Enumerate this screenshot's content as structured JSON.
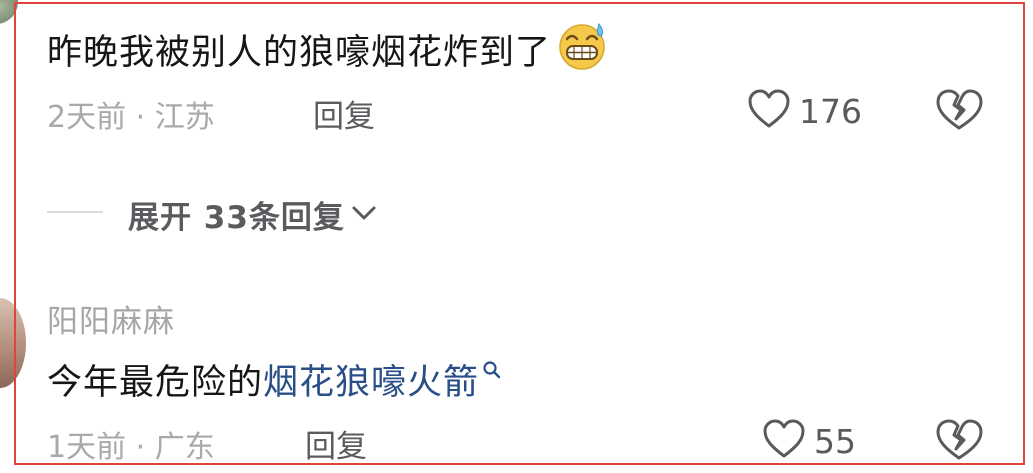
{
  "comment1": {
    "text": "昨晚我被别人的狼嚎烟花炸到了",
    "emoji": "grinning-sweat-emoji",
    "time_location": "2天前 · 江苏",
    "reply_label": "回复",
    "like_count": "176"
  },
  "expand": {
    "label": "展开 33条回复"
  },
  "comment2": {
    "username": "阳阳麻麻",
    "text_plain": "今年最危险的",
    "text_link": "烟花狼嚎火箭",
    "time_location": "1天前 · 广东",
    "reply_label": "回复",
    "like_count": "55"
  },
  "colors": {
    "frame": "#e0453a",
    "link": "#2a4f87",
    "meta": "#a9a9ab",
    "text": "#161616"
  },
  "icons": [
    "heart-outline-icon",
    "broken-heart-icon",
    "chevron-down-icon",
    "search-icon"
  ]
}
